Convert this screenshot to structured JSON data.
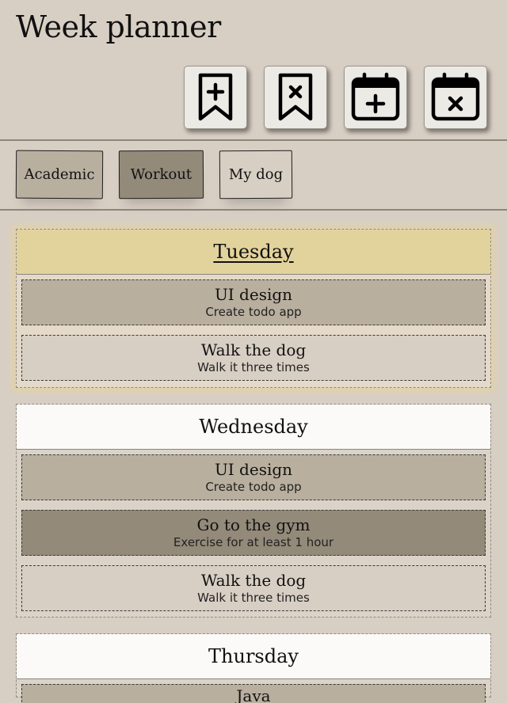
{
  "app": {
    "title": "Week planner"
  },
  "toolbar": [
    {
      "name": "add-tag-button",
      "icon": "bookmark-plus-icon"
    },
    {
      "name": "remove-tag-button",
      "icon": "bookmark-x-icon"
    },
    {
      "name": "add-event-button",
      "icon": "calendar-plus-icon"
    },
    {
      "name": "remove-event-button",
      "icon": "calendar-x-icon"
    }
  ],
  "tags": [
    {
      "label": "Academic",
      "color": "#b9af9f"
    },
    {
      "label": "Workout",
      "color": "#938a7a"
    },
    {
      "label": "My dog",
      "color": "#d8cfc4"
    }
  ],
  "days": [
    {
      "name": "Tuesday",
      "current": true,
      "tasks": [
        {
          "title": "UI design",
          "description": "Create todo app",
          "tag": "academic"
        },
        {
          "title": "Walk the dog",
          "description": "Walk it three times",
          "tag": "mydog"
        }
      ]
    },
    {
      "name": "Wednesday",
      "current": false,
      "tasks": [
        {
          "title": "UI design",
          "description": "Create todo app",
          "tag": "academic"
        },
        {
          "title": "Go to the gym",
          "description": "Exercise for at least 1 hour",
          "tag": "workout"
        },
        {
          "title": "Walk the dog",
          "description": "Walk it three times",
          "tag": "mydog"
        }
      ]
    },
    {
      "name": "Thursday",
      "current": false,
      "tasks": [
        {
          "title": "Java",
          "description": "",
          "tag": "academic"
        }
      ]
    }
  ]
}
